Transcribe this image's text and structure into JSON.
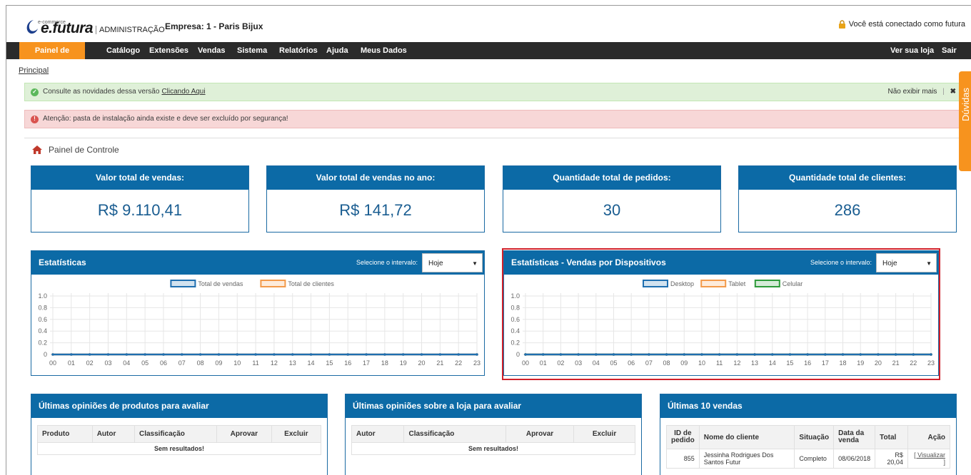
{
  "header": {
    "logo_text": "e.futura",
    "logo_sub": "e-commerce",
    "admin_label": "ADMINISTRAÇÃO",
    "company": "Empresa: 1 - Paris Bijux",
    "connected": "Você está conectado como futura"
  },
  "nav": {
    "items": [
      "Painel de controle",
      "Catálogo",
      "Extensões",
      "Vendas",
      "Sistema",
      "Relatórios",
      "Ajuda",
      "Meus Dados"
    ],
    "right": [
      "Ver sua loja",
      "Sair"
    ]
  },
  "breadcrumb": "Principal",
  "alerts": {
    "success_text": "Consulte as novidades dessa versão",
    "success_link": "Clicando Aqui",
    "dismiss": "Não exibir mais",
    "separator": "|",
    "close": "✖",
    "danger_text": "Atenção: pasta de instalação ainda existe e deve ser excluído por segurança!"
  },
  "page_title": "Painel de Controle",
  "side_tab": "Dúvidas",
  "stats": [
    {
      "label": "Valor total de vendas:",
      "value": "R$ 9.110,41"
    },
    {
      "label": "Valor total de vendas no ano:",
      "value": "R$ 141,72"
    },
    {
      "label": "Quantidade total de pedidos:",
      "value": "30"
    },
    {
      "label": "Quantidade total de clientes:",
      "value": "286"
    }
  ],
  "charts": {
    "interval_label": "Selecione o intervalo:",
    "interval_value": "Hoje",
    "left_title": "Estatísticas",
    "right_title": "Estatísticas - Vendas por Dispositivos"
  },
  "chart_data": [
    {
      "type": "line",
      "title": "",
      "xlabel": "",
      "ylabel": "",
      "x": [
        "00",
        "01",
        "02",
        "03",
        "04",
        "05",
        "06",
        "07",
        "08",
        "09",
        "10",
        "11",
        "12",
        "13",
        "14",
        "15",
        "16",
        "17",
        "18",
        "19",
        "20",
        "21",
        "22",
        "23"
      ],
      "yticks": [
        "0",
        "0.2",
        "0.4",
        "0.6",
        "0.8",
        "1.0"
      ],
      "ylim": [
        0,
        1
      ],
      "grid": true,
      "legend_position": "top-center",
      "series": [
        {
          "name": "Total de vendas",
          "color": "#1f6fb0",
          "values": [
            0,
            0,
            0,
            0,
            0,
            0,
            0,
            0,
            0,
            0,
            0,
            0,
            0,
            0,
            0,
            0,
            0,
            0,
            0,
            0,
            0,
            0,
            0,
            0
          ]
        },
        {
          "name": "Total de clientes",
          "color": "#f39a4a",
          "values": [
            0,
            0,
            0,
            0,
            0,
            0,
            0,
            0,
            0,
            0,
            0,
            0,
            0,
            0,
            0,
            0,
            0,
            0,
            0,
            0,
            0,
            0,
            0,
            0
          ]
        }
      ]
    },
    {
      "type": "line",
      "title": "",
      "xlabel": "",
      "ylabel": "",
      "x": [
        "00",
        "01",
        "02",
        "03",
        "04",
        "05",
        "06",
        "07",
        "08",
        "09",
        "10",
        "11",
        "12",
        "13",
        "14",
        "15",
        "16",
        "17",
        "18",
        "19",
        "20",
        "21",
        "22",
        "23"
      ],
      "yticks": [
        "0",
        "0.2",
        "0.4",
        "0.6",
        "0.8",
        "1.0"
      ],
      "ylim": [
        0,
        1
      ],
      "grid": true,
      "legend_position": "top-center",
      "series": [
        {
          "name": "Desktop",
          "color": "#1f6fb0",
          "values": [
            0,
            0,
            0,
            0,
            0,
            0,
            0,
            0,
            0,
            0,
            0,
            0,
            0,
            0,
            0,
            0,
            0,
            0,
            0,
            0,
            0,
            0,
            0,
            0
          ]
        },
        {
          "name": "Tablet",
          "color": "#f39a4a",
          "values": [
            0,
            0,
            0,
            0,
            0,
            0,
            0,
            0,
            0,
            0,
            0,
            0,
            0,
            0,
            0,
            0,
            0,
            0,
            0,
            0,
            0,
            0,
            0,
            0
          ]
        },
        {
          "name": "Celular",
          "color": "#2e9b3a",
          "values": [
            0,
            0,
            0,
            0,
            0,
            0,
            0,
            0,
            0,
            0,
            0,
            0,
            0,
            0,
            0,
            0,
            0,
            0,
            0,
            0,
            0,
            0,
            0,
            0
          ]
        }
      ]
    }
  ],
  "lower": {
    "products_title": "Últimas opiniões de produtos para avaliar",
    "products_cols": [
      "Produto",
      "Autor",
      "Classificação",
      "Aprovar",
      "Excluir"
    ],
    "store_title": "Últimas opiniões sobre a loja para avaliar",
    "store_cols": [
      "Autor",
      "Classificação",
      "Aprovar",
      "Excluir"
    ],
    "empty": "Sem resultados!",
    "sales_title": "Últimas 10 vendas",
    "sales_cols": [
      "ID de pedido",
      "Nome do cliente",
      "Situação",
      "Data da venda",
      "Total",
      "Ação"
    ],
    "sales_rows": [
      {
        "id": "855",
        "name": "Jessinha Rodrigues Dos Santos Futur",
        "status": "Completo",
        "date": "08/06/2018",
        "total": "R$ 20,04",
        "action": "[ Visualizar ]"
      }
    ]
  }
}
